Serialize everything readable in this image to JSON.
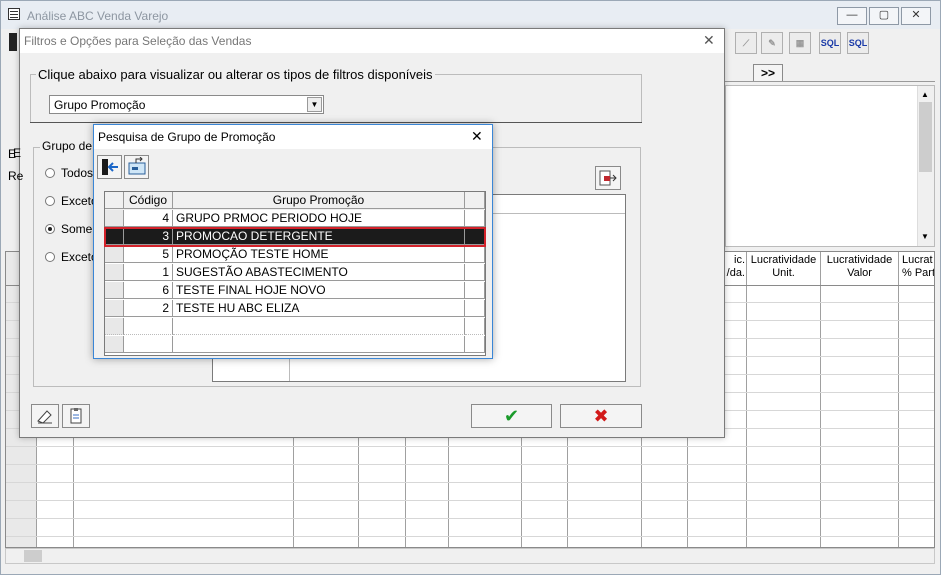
{
  "main": {
    "title": "Análise ABC Venda Varejo",
    "min_glyph": "—",
    "max_glyph": "▢",
    "close_glyph": "✕",
    "nav_label": ">>",
    "toolbar": {
      "sql1": "SQL",
      "sql2": "SQL"
    },
    "grid_headers": {
      "partial": "ic.\n/da.",
      "lucro_unit": "Lucratividade\nUnit.",
      "lucro_valor": "Lucratividade\nValor",
      "lucro_part": "Lucrat\n% Parti"
    }
  },
  "filter_dialog": {
    "title": "Filtros e Opções para Seleção das Vendas",
    "close_glyph": "✕",
    "section_label": "Clique abaixo para visualizar ou alterar os tipos de filtros disponíveis",
    "filter_select_value": "Grupo Promoção",
    "group_label": "Grupo de F",
    "radios": [
      {
        "label": "Todos",
        "checked": false
      },
      {
        "label": "Exceto",
        "checked": false
      },
      {
        "label": "Somen",
        "checked": true
      },
      {
        "label": "Exceto",
        "checked": false
      }
    ],
    "side_labels": [
      "E",
      "Re",
      "D"
    ],
    "ok_glyph": "✔",
    "cancel_glyph": "✖"
  },
  "search_dialog": {
    "title": "Pesquisa de Grupo de Promoção",
    "close_glyph": "✕",
    "columns": [
      "Código",
      "Grupo Promoção"
    ],
    "rows": [
      {
        "code": "4",
        "name": "GRUPO PRMOC PERIODO HOJE",
        "selected": false
      },
      {
        "code": "3",
        "name": "PROMOCAO DETERGENTE",
        "selected": true
      },
      {
        "code": "5",
        "name": "PROMOÇÃO TESTE HOME",
        "selected": false
      },
      {
        "code": "1",
        "name": "SUGESTÃO ABASTECIMENTO",
        "selected": false
      },
      {
        "code": "6",
        "name": "TESTE FINAL HOJE NOVO",
        "selected": false
      },
      {
        "code": "2",
        "name": "TESTE HU ABC ELIZA",
        "selected": false
      }
    ],
    "highlight_color": "#d3222a"
  }
}
